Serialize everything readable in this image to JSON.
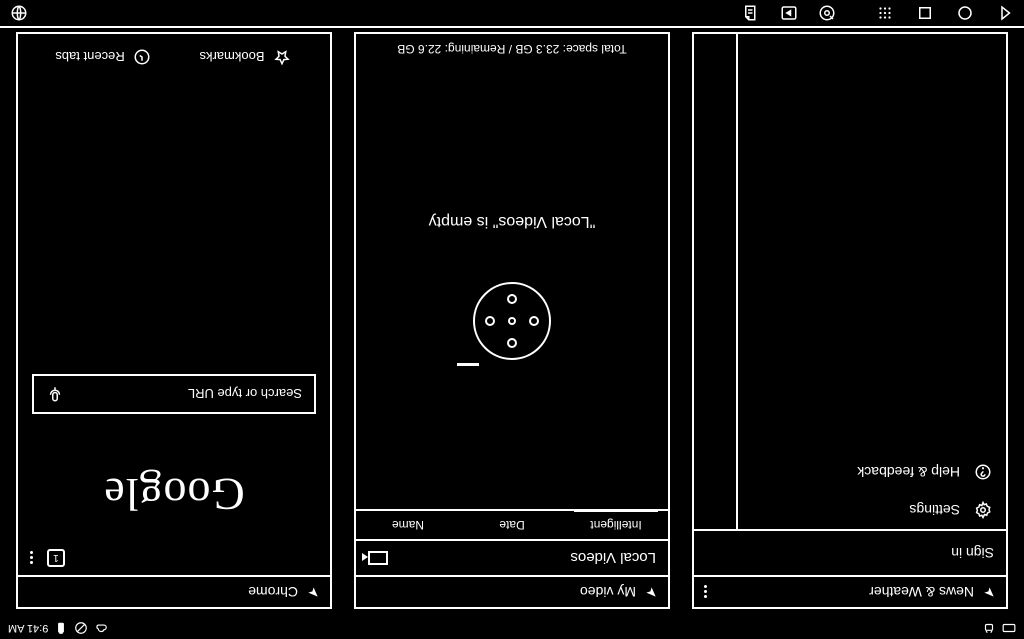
{
  "statusbar": {
    "time": "9:41 AM"
  },
  "navbar": {},
  "news": {
    "title": "News & Weather",
    "signin": "Sign in",
    "settings": "Settings",
    "help": "Help & feedback"
  },
  "video": {
    "title": "My video",
    "sub": "Local Videos",
    "tabs": {
      "a": "Intelligent",
      "b": "Date",
      "c": "Name"
    },
    "empty": "\"Local Videos\" is empty",
    "storage": "Total space: 23.3 GB / Remaining: 22.6 GB"
  },
  "chrome": {
    "title": "Chrome",
    "tabcount": "1",
    "logo": "Google",
    "search_placeholder": "Search or type URL",
    "bookmarks": "Bookmarks",
    "recent": "Recent tabs"
  }
}
